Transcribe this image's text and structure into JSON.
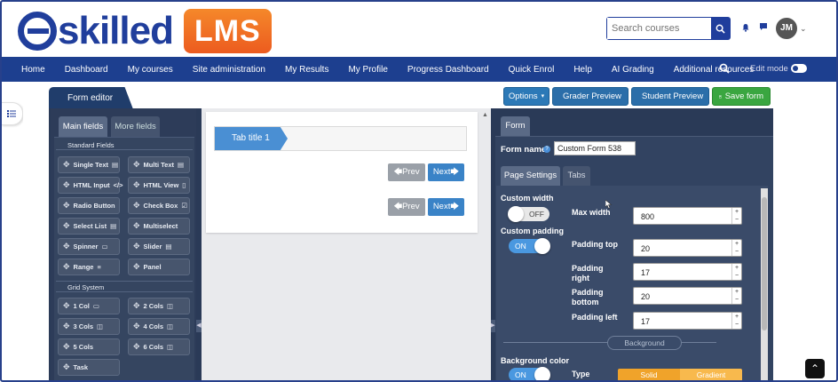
{
  "brand": {
    "logo_text": "skilled",
    "lms_badge": "LMS"
  },
  "header": {
    "search_placeholder": "Search courses",
    "avatar_initials": "JM"
  },
  "nav": {
    "items": [
      "Home",
      "Dashboard",
      "My courses",
      "Site administration",
      "My Results",
      "My Profile",
      "Progress Dashboard",
      "Quick Enrol",
      "Help",
      "AI Grading",
      "Additional resources"
    ],
    "edit_mode_label": "Edit mode"
  },
  "toolbar": {
    "editor_tab": "Form editor",
    "options": "Options",
    "grader_preview": "Grader Preview",
    "student_preview": "Student Preview",
    "save_form": "Save form"
  },
  "palette": {
    "tabs": [
      "Main fields",
      "More fields"
    ],
    "standard_title": "Standard Fields",
    "standard": [
      "Single Text",
      "Multi Text",
      "HTML Input",
      "HTML View",
      "Radio Button",
      "Check Box",
      "Select List",
      "Multiselect",
      "Spinner",
      "Slider",
      "Range",
      "Panel"
    ],
    "grid_title": "Grid System",
    "grid": [
      "1 Col",
      "2 Cols",
      "3 Cols",
      "4 Cols",
      "5 Cols",
      "6 Cols",
      "Task"
    ]
  },
  "canvas": {
    "tab_title": "Tab title 1",
    "prev": "Prev",
    "next": "Next"
  },
  "props": {
    "tab": "Form",
    "form_name_label": "Form name",
    "form_name_value": "Custom Form 538",
    "subtabs": [
      "Page Settings",
      "Tabs"
    ],
    "custom_width_label": "Custom width",
    "custom_width_state": "OFF",
    "max_width_label": "Max width",
    "max_width_value": "800",
    "custom_padding_label": "Custom padding",
    "custom_padding_state": "ON",
    "padding_top_label": "Padding top",
    "padding_top_value": "20",
    "padding_right_label": "Padding right",
    "padding_right_value": "17",
    "padding_bottom_label": "Padding bottom",
    "padding_bottom_value": "20",
    "padding_left_label": "Padding left",
    "padding_left_value": "17",
    "background_divider": "Background",
    "background_color_label": "Background color",
    "background_color_state": "ON",
    "type_label": "Type",
    "type_options": [
      "Solid",
      "Gradient"
    ]
  },
  "colors": {
    "brand_blue": "#203e9c",
    "nav_bg": "#1d3f8f",
    "save_green": "#3aa640",
    "lms_orange": "#f5882a"
  }
}
